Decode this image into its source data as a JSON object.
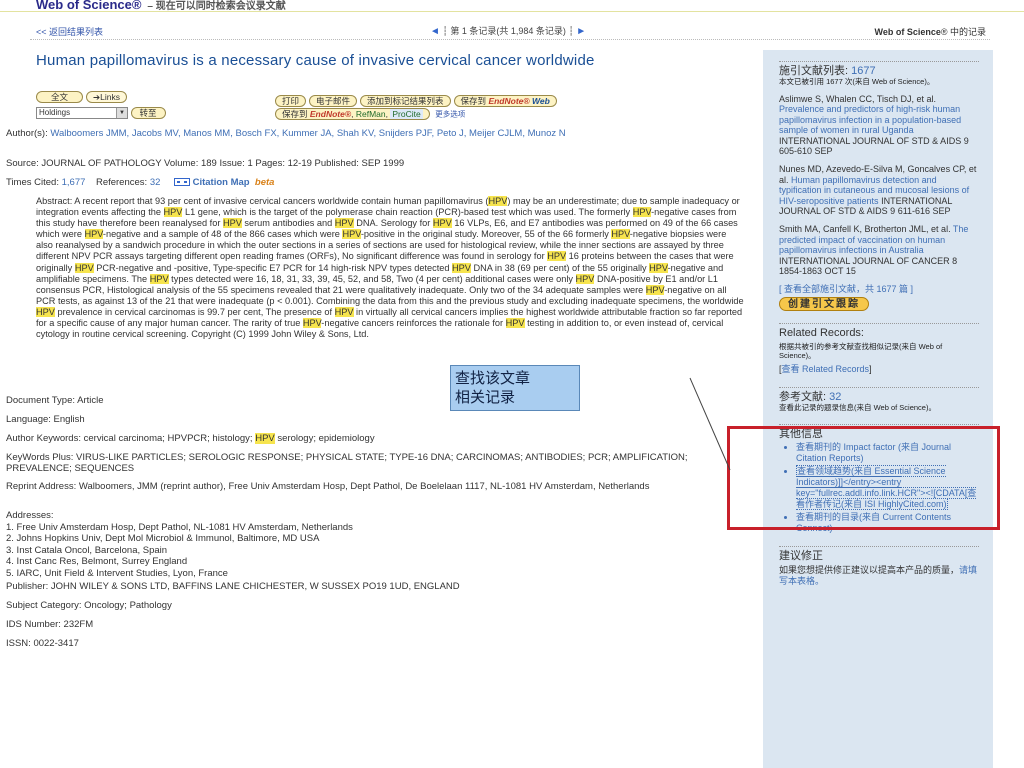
{
  "header": {
    "brand": "Web of Science®",
    "tagline": "– 现在可以同时检索会议录文献"
  },
  "nav": {
    "back": "<< 返回结果列表",
    "pager": "第 1 条记录(共 1,984 条记录)",
    "right_brand": "Web of Science",
    "right_suffix": "® 中的记录"
  },
  "record": {
    "title": "Human papillomavirus is a necessary cause of invasive cervical cancer worldwide",
    "buttons": {
      "fulltext": "全文",
      "links": "Links",
      "print": "打印",
      "email": "电子邮件",
      "add_marked": "添加到标记结果列表",
      "save_to": "保存到",
      "endnote": "EndNote®",
      "endnote_web": "Web",
      "save_to2": "保存到",
      "refman": "RefMan",
      "procite": "ProCite",
      "more": "更多选项",
      "holdings": "Holdings",
      "goto": "转至"
    },
    "authors_label": "Author(s):",
    "authors": "Walboomers JMM, Jacobs MV, Manos MM, Bosch FX, Kummer JA, Shah KV, Snijders PJF, Peto J, Meijer CJLM, Munoz N",
    "source_line": "Source: JOURNAL OF PATHOLOGY    Volume: 189    Issue: 1    Pages: 12-19    Published: SEP 1999",
    "times_cited_label": "Times Cited:",
    "times_cited": "1,677",
    "references_label": "References:",
    "references": "32",
    "citation_map": "Citation Map",
    "beta": "beta",
    "doc_type": "Document Type: Article",
    "language": "Language: English",
    "author_keywords_pre": "Author Keywords: cervical carcinoma; HPVPCR; histology;",
    "author_keywords_hpv": "HPV",
    "author_keywords_post": "serology; epidemiology",
    "keywords_plus": "KeyWords Plus: VIRUS-LIKE PARTICLES; SEROLOGIC RESPONSE; PHYSICAL STATE; TYPE-16 DNA; CARCINOMAS; ANTIBODIES; PCR; AMPLIFICATION; PREVALENCE; SEQUENCES",
    "reprint": "Reprint Address: Walboomers, JMM (reprint author), Free Univ Amsterdam Hosp, Dept Pathol, De Boelelaan 1117, NL-1081 HV Amsterdam, Netherlands",
    "addresses_label": "Addresses:",
    "addresses": [
      "1. Free Univ Amsterdam Hosp, Dept Pathol, NL-1081 HV Amsterdam, Netherlands",
      "2. Johns Hopkins Univ, Dept Mol Microbiol & Immunol, Baltimore, MD USA",
      "3. Inst Catala Oncol, Barcelona, Spain",
      "4. Inst Canc Res, Belmont, Surrey England",
      "5. IARC, Unit Field & Intervent Studies, Lyon, France"
    ],
    "publisher": "Publisher: JOHN WILEY & SONS LTD, BAFFINS LANE CHICHESTER, W SUSSEX PO19 1UD, ENGLAND",
    "subject": "Subject Category: Oncology; Pathology",
    "ids": "IDS Number: 232FM",
    "issn": "ISSN: 0022-3417"
  },
  "callout": {
    "line1": "查找该文章",
    "line2": "相关记录"
  },
  "sidebar": {
    "cited_label": "施引文献列表:",
    "cited_count": "1677",
    "cited_note": "本文已被引用 1677 次(来自 Web of Science)。",
    "citations": [
      {
        "authors": "Aslimwe S, Whalen CC, Tisch DJ, et al.",
        "title": "Prevalence and predictors of high-risk human papillomavirus infection in a population-based sample of women in rural Uganda",
        "src": "INTERNATIONAL JOURNAL OF STD & AIDS 9 605-610 SEP"
      },
      {
        "authors": "Nunes MD, Azevedo-E-Silva M, Goncalves CP, et al.",
        "title": "Human papillomavirus detection and typification in cutaneous and mucosal lesions of HIV-seropositive patients",
        "src": "INTERNATIONAL JOURNAL OF STD & AIDS 9 611-616 SEP"
      },
      {
        "authors": "Smith MA, Canfell K, Brotherton JML, et al.",
        "title": "The predicted impact of vaccination on human papillomavirus infections in Australia",
        "src": "INTERNATIONAL JOURNAL OF CANCER 8 1854-1863 OCT 15"
      }
    ],
    "view_all": "[ 查看全部施引文献，共 1677 篇 ]",
    "create_report": "创建引文跟踪",
    "related_title": "Related Records:",
    "related_note": "根据共被引的参考文献查找相似记录(来自 Web of Science)。",
    "related_link": "查看 Related Records",
    "refs_label": "参考文献:",
    "refs_count": "32",
    "refs_note": "查看此记录的题录信息(来自 Web of Science)。",
    "other_title": "其他信息",
    "other_items": [
      "查看期刊的 Impact factor (来自 Journal Citation Reports)",
      "查看领域趋势(来自 Essential Science Indicators)]]</entry><entry key=\"fullrec.addl.info.link.HCR\"><![CDATA[查看作者传记(来自 ISI HighlyCited.com)",
      "查看期刊的目录(来自 Current Contents Connect)"
    ],
    "suggest_title": "建议修正",
    "suggest_text": "如果您想提供修正建议以提高本产品的质量，",
    "suggest_link": "请填写本表格。"
  },
  "colors": {
    "accent": "#1a4f95",
    "highlight": "#f6e44e",
    "sidebar_bg": "#dbe6f1",
    "red_box": "#c8202a"
  }
}
